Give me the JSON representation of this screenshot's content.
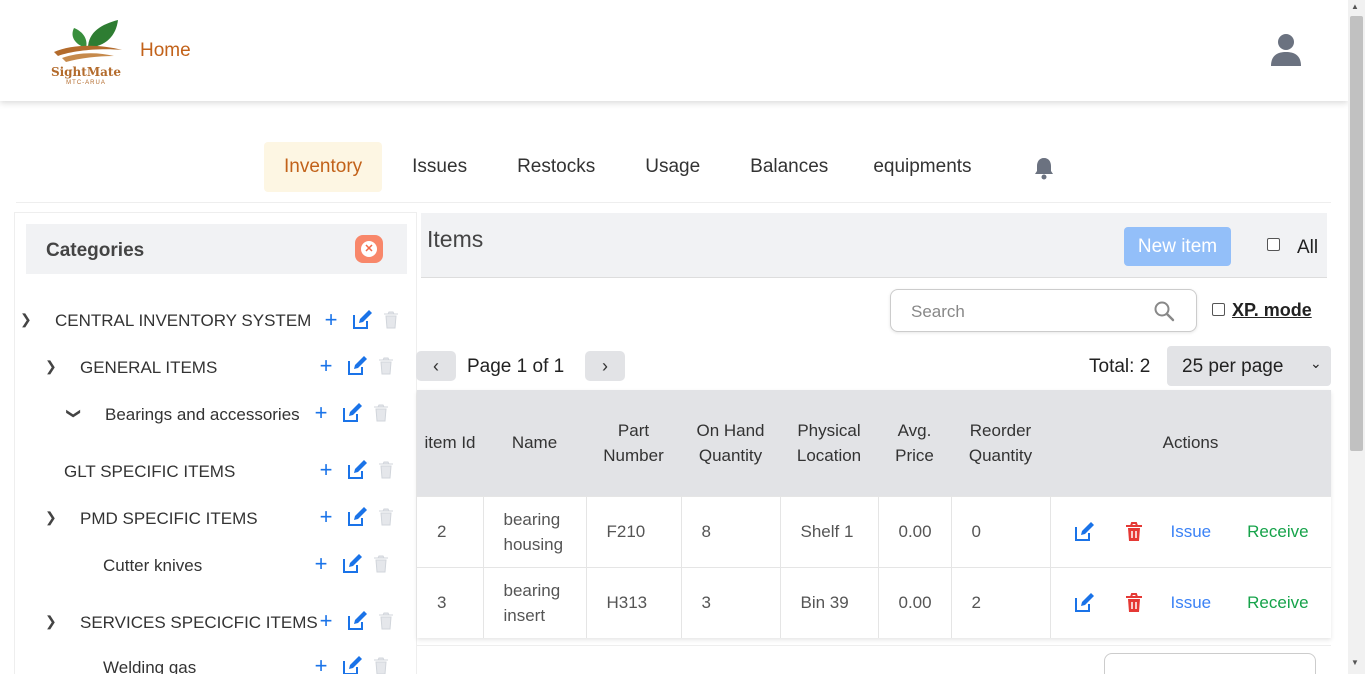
{
  "brand": {
    "name": "SightMate",
    "sub": "MTC-ARUA"
  },
  "header": {
    "home_label": "Home"
  },
  "tabs": [
    {
      "label": "Inventory",
      "active": true
    },
    {
      "label": "Issues"
    },
    {
      "label": "Restocks"
    },
    {
      "label": "Usage"
    },
    {
      "label": "Balances"
    },
    {
      "label": "equipments"
    }
  ],
  "sidebar": {
    "title": "Categories",
    "categories": [
      {
        "label": "CENTRAL INVENTORY SYSTEM",
        "expand": "collapsed"
      },
      {
        "label": "GENERAL ITEMS",
        "expand": "collapsed"
      },
      {
        "label": "Bearings and accessories",
        "expand": "expanded"
      },
      {
        "label": "GLT SPECIFIC ITEMS",
        "expand": "none"
      },
      {
        "label": "PMD SPECIFIC ITEMS",
        "expand": "collapsed"
      },
      {
        "label": "Cutter knives",
        "expand": "none"
      },
      {
        "label": "SERVICES SPECICFIC ITEMS",
        "expand": "collapsed"
      },
      {
        "label": "Welding gas",
        "expand": "none"
      }
    ]
  },
  "items": {
    "title": "Items",
    "new_item_label": "New item",
    "all_label": "All",
    "search_placeholder": "Search",
    "xp_mode_label": "XP. mode",
    "page_text": "Page 1 of 1",
    "total_text": "Total: 2",
    "per_page": "25 per page"
  },
  "table": {
    "headers": [
      "item Id",
      "Name",
      "Part Number",
      "On Hand Quantity",
      "Physical Location",
      "Avg. Price",
      "Reorder Quantity",
      "Actions"
    ],
    "rows": [
      {
        "id": "2",
        "name": "bearing housing",
        "part": "F210",
        "qty": "8",
        "location": "Shelf 1",
        "price": "0.00",
        "reorder": "0",
        "issue": "Issue",
        "receive": "Receive"
      },
      {
        "id": "3",
        "name": "bearing insert",
        "part": "H313",
        "qty": "3",
        "location": "Bin 39",
        "price": "0.00",
        "reorder": "2",
        "issue": "Issue",
        "receive": "Receive"
      }
    ]
  },
  "colors": {
    "accent": "#c2621a",
    "primary": "#1a73e8",
    "danger": "#e53935",
    "success": "#16a34a"
  }
}
